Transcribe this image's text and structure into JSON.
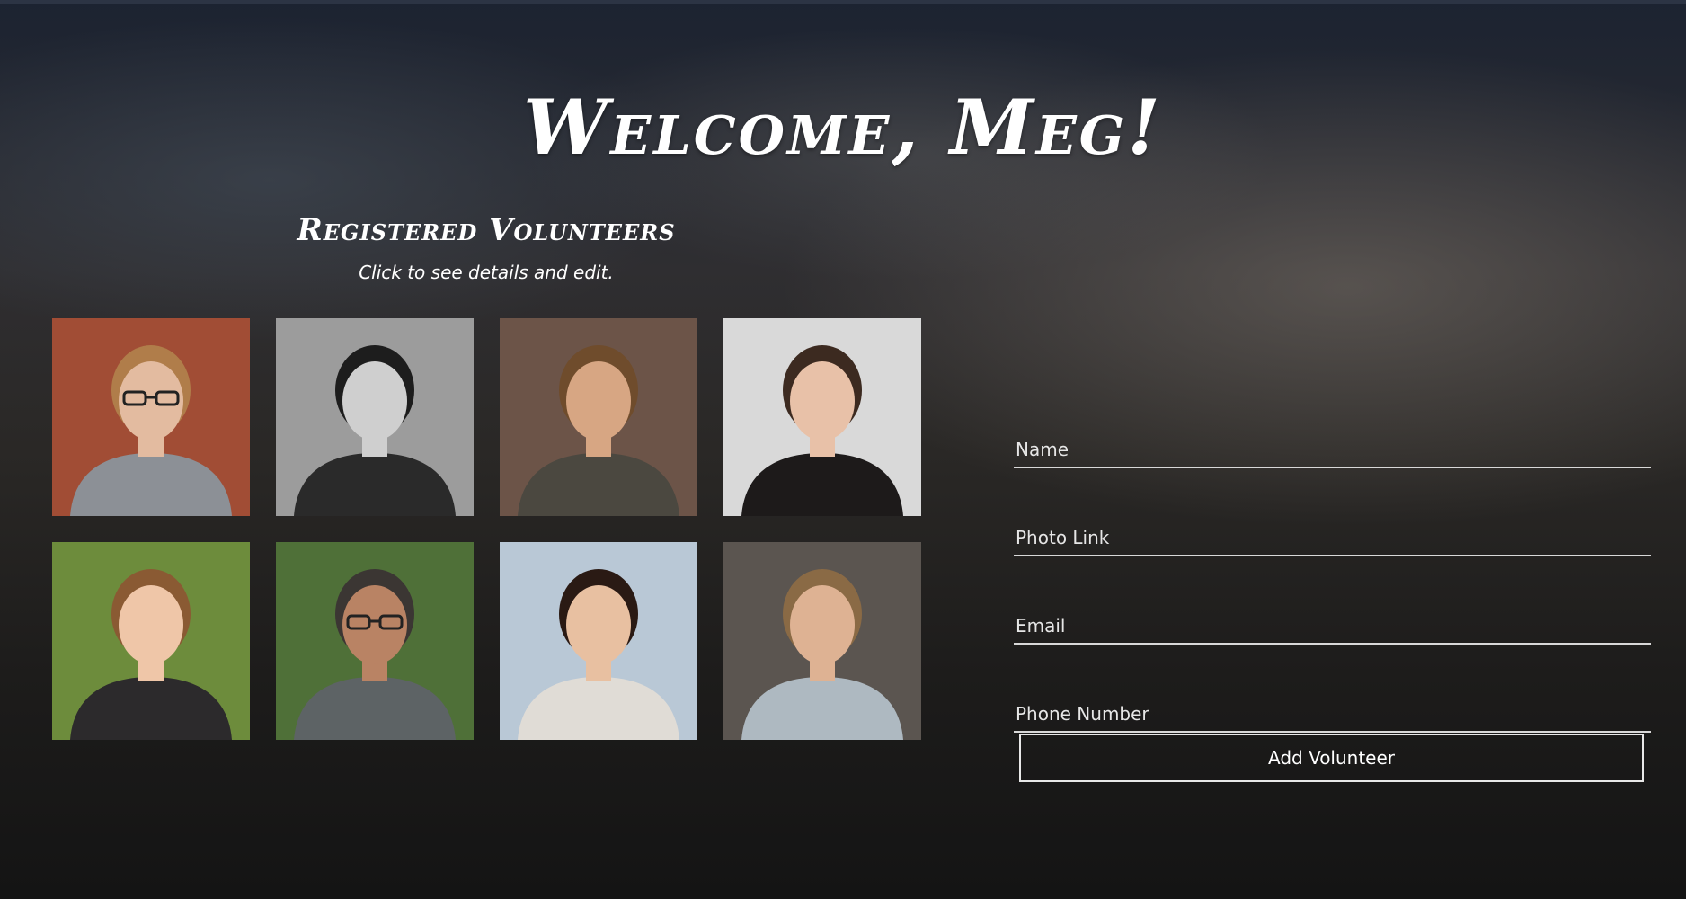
{
  "header": {
    "title": "Welcome, Meg!"
  },
  "volunteers": {
    "heading": "Registered Volunteers",
    "subheading": "Click to see details and edit.",
    "photos": [
      {
        "skin": "#e3bba0",
        "hair": "#b07d4a",
        "shirt": "#8c9096",
        "bg": "#a14d35",
        "glasses": true
      },
      {
        "skin": "#cfcfcf",
        "hair": "#1d1d1d",
        "shirt": "#2a2a2a",
        "bg": "#9c9c9c",
        "glasses": false
      },
      {
        "skin": "#d7a683",
        "hair": "#6f4c2c",
        "shirt": "#4b4840",
        "bg": "#6c5448",
        "glasses": false
      },
      {
        "skin": "#e8c1a8",
        "hair": "#3c2a20",
        "shirt": "#1d1a1a",
        "bg": "#d9d9d9",
        "glasses": false
      },
      {
        "skin": "#efc6a8",
        "hair": "#8a5a33",
        "shirt": "#2c2a2c",
        "bg": "#6d8c3c",
        "glasses": false
      },
      {
        "skin": "#b98364",
        "hair": "#3b3633",
        "shirt": "#5d6365",
        "bg": "#4f7038",
        "glasses": true
      },
      {
        "skin": "#e8c0a1",
        "hair": "#2a1a14",
        "shirt": "#e0dcd6",
        "bg": "#b9c8d6",
        "glasses": false
      },
      {
        "skin": "#deb293",
        "hair": "#8a6a45",
        "shirt": "#aeb9c1",
        "bg": "#5b5550",
        "glasses": false
      }
    ]
  },
  "form": {
    "name_placeholder": "Name",
    "photo_placeholder": "Photo Link",
    "email_placeholder": "Email",
    "phone_placeholder": "Phone Number",
    "submit_label": "Add Volunteer"
  }
}
